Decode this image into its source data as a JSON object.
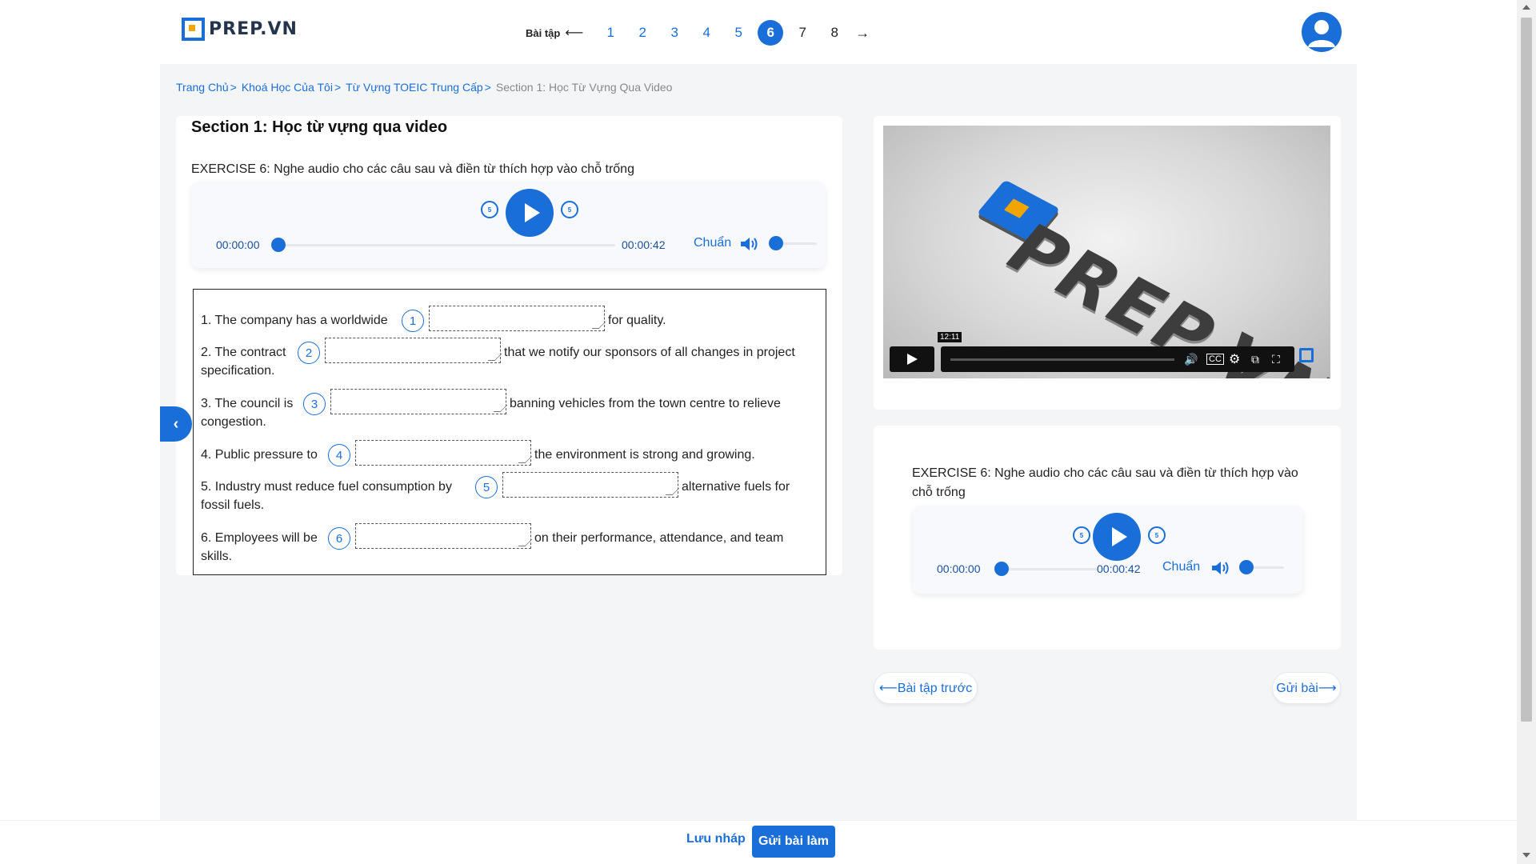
{
  "brand": {
    "name": "PREP.VN",
    "accent": "#1a6ed8"
  },
  "exercise_nav": {
    "label": "Bài tập",
    "prev_arrow": "⟵",
    "next_arrow": "→",
    "numbers": [
      "1",
      "2",
      "3",
      "4",
      "5",
      "6",
      "7",
      "8"
    ],
    "active": "6"
  },
  "breadcrumb": {
    "items": [
      "Trang Chủ",
      "Khoá Học Của Tôi",
      "Từ Vựng TOEIC Trung Cấp"
    ],
    "separator": ">",
    "current": "Section 1: Học Từ Vựng Qua Video"
  },
  "left": {
    "section_title": "Section 1: Học từ vựng qua video",
    "exercise_instruction": "EXERCISE 6: Nghe audio cho các câu sau và điền từ thích hợp vào chỗ trống",
    "player": {
      "current_time": "00:00:00",
      "duration": "00:00:42",
      "progress": 0,
      "speed": "Chuẩn",
      "volume": 0,
      "skip_back": "5",
      "skip_forward": "5"
    },
    "questions": [
      {
        "before": "1. The company has a worldwide",
        "number": "1",
        "after": "for quality.",
        "cont": ""
      },
      {
        "before": "2. The contract",
        "number": "2",
        "after": "that we notify our sponsors of all changes in project",
        "cont": "specification."
      },
      {
        "before": "3. The council is",
        "number": "3",
        "after": "banning vehicles from the town centre to relieve",
        "cont": "congestion."
      },
      {
        "before": "4. Public pressure to",
        "number": "4",
        "after": "the environment is strong and growing.",
        "cont": ""
      },
      {
        "before": "5. Industry must reduce fuel consumption by",
        "number": "5",
        "after": "alternative fuels for",
        "cont": "fossil fuels."
      },
      {
        "before": "6. Employees will be",
        "number": "6",
        "after": "on their performance, attendance, and team",
        "cont": "skills."
      }
    ],
    "answers": [
      "",
      "",
      "",
      "",
      "",
      ""
    ]
  },
  "video": {
    "timestamp": "12:11",
    "progress": 0,
    "icons": [
      "play-icon",
      "volume-icon",
      "captions-icon",
      "settings-icon",
      "miniplayer-icon",
      "fullscreen-icon"
    ]
  },
  "right": {
    "exercise_instruction": "EXERCISE 6: Nghe audio cho các câu sau và điền từ thích hợp vào chỗ trống",
    "player": {
      "current_time": "00:00:00",
      "duration": "00:00:42",
      "progress": 0,
      "speed": "Chuẩn",
      "volume": 0,
      "skip_back": "5",
      "skip_forward": "5"
    },
    "prev_button": "⟵Bài tập trước",
    "submit_exercise_button": "Gửi bài⟶"
  },
  "footer": {
    "save_draft": "Lưu nháp",
    "submit": "Gửi bài làm"
  }
}
